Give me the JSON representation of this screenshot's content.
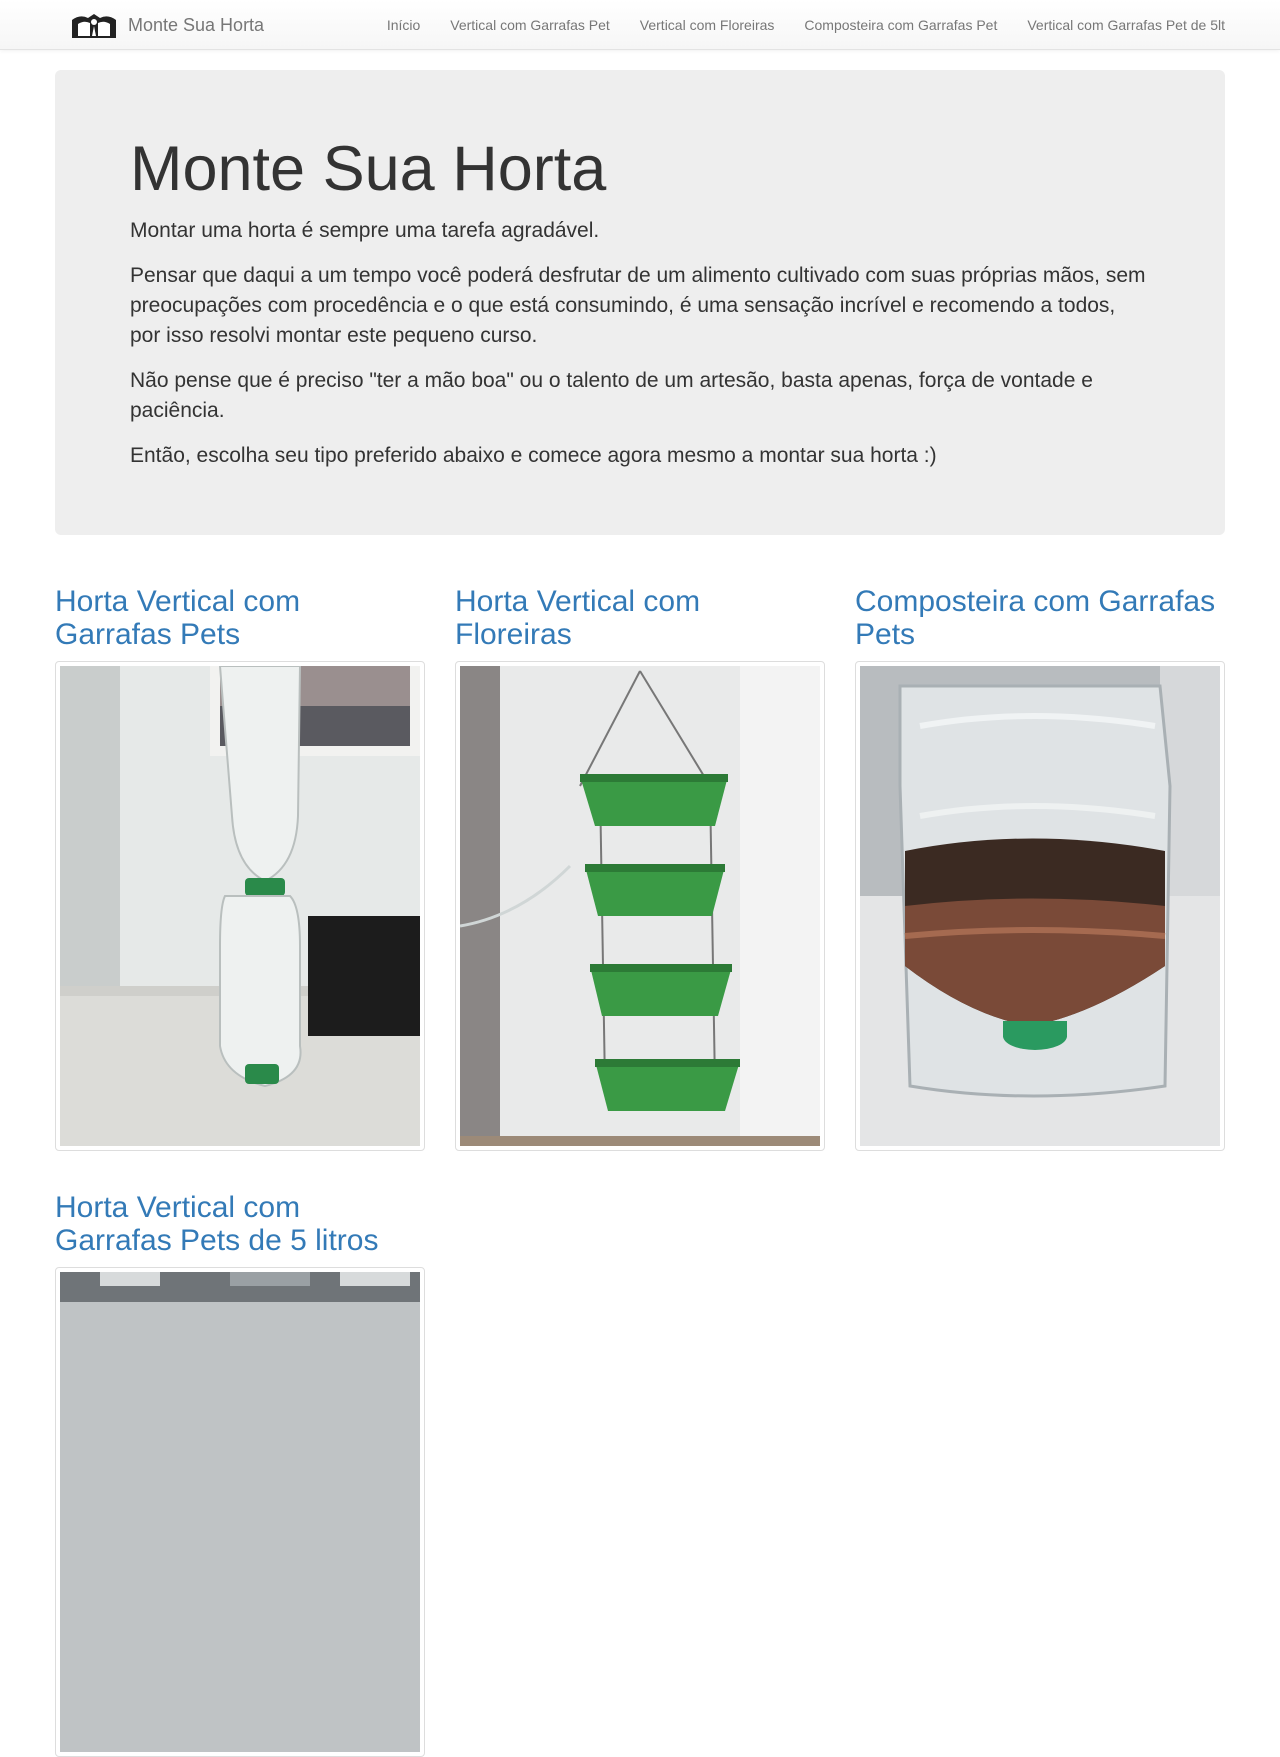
{
  "navbar": {
    "brand": "Monte Sua Horta",
    "links": [
      {
        "label": "Início"
      },
      {
        "label": "Vertical com Garrafas Pet"
      },
      {
        "label": "Vertical com Floreiras"
      },
      {
        "label": "Composteira com Garrafas Pet"
      },
      {
        "label": "Vertical com Garrafas Pet de 5lt"
      }
    ]
  },
  "hero": {
    "title": "Monte Sua Horta",
    "paragraphs": [
      "Montar uma horta é sempre uma tarefa agradável.",
      "Pensar que daqui a um tempo você poderá desfrutar de um alimento cultivado com suas próprias mãos, sem preocupações com procedência e o que está consumindo, é uma sensação incrível e recomendo a todos, por isso resolvi montar este pequeno curso.",
      "Não pense que é preciso \"ter a mão boa\" ou o talento de um artesão, basta apenas, força de vontade e paciência.",
      "Então, escolha seu tipo preferido abaixo e comece agora mesmo a montar sua horta :)"
    ]
  },
  "cards": [
    {
      "title": "Horta Vertical com Garrafas Pets"
    },
    {
      "title": "Horta Vertical com Floreiras"
    },
    {
      "title": "Composteira com Garrafas Pets"
    },
    {
      "title": "Horta Vertical com Garrafas Pets de 5 litros"
    }
  ],
  "colors": {
    "link": "#337ab7",
    "jumbotron_bg": "#eeeeee",
    "planter_green": "#3a9a45"
  }
}
